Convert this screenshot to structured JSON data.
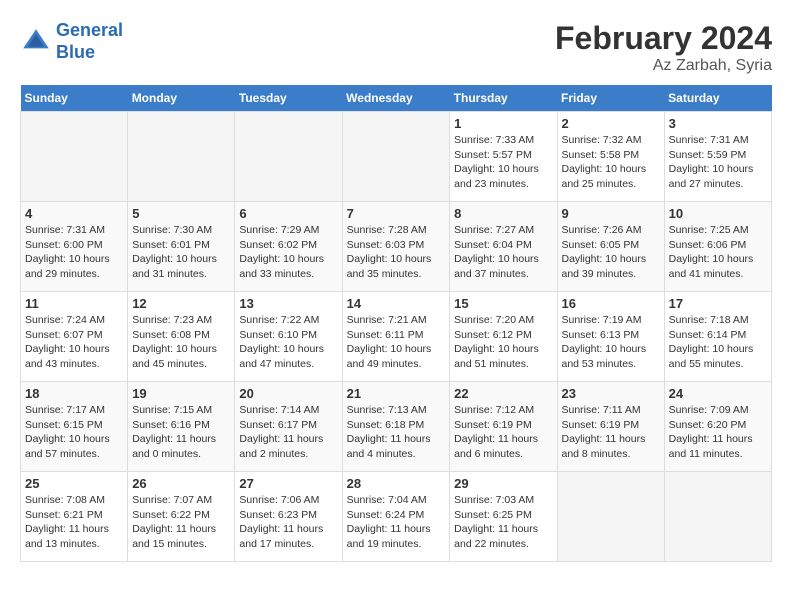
{
  "header": {
    "logo_line1": "General",
    "logo_line2": "Blue",
    "month_year": "February 2024",
    "location": "Az Zarbah, Syria"
  },
  "weekdays": [
    "Sunday",
    "Monday",
    "Tuesday",
    "Wednesday",
    "Thursday",
    "Friday",
    "Saturday"
  ],
  "weeks": [
    [
      {
        "day": "",
        "info": ""
      },
      {
        "day": "",
        "info": ""
      },
      {
        "day": "",
        "info": ""
      },
      {
        "day": "",
        "info": ""
      },
      {
        "day": "1",
        "info": "Sunrise: 7:33 AM\nSunset: 5:57 PM\nDaylight: 10 hours\nand 23 minutes."
      },
      {
        "day": "2",
        "info": "Sunrise: 7:32 AM\nSunset: 5:58 PM\nDaylight: 10 hours\nand 25 minutes."
      },
      {
        "day": "3",
        "info": "Sunrise: 7:31 AM\nSunset: 5:59 PM\nDaylight: 10 hours\nand 27 minutes."
      }
    ],
    [
      {
        "day": "4",
        "info": "Sunrise: 7:31 AM\nSunset: 6:00 PM\nDaylight: 10 hours\nand 29 minutes."
      },
      {
        "day": "5",
        "info": "Sunrise: 7:30 AM\nSunset: 6:01 PM\nDaylight: 10 hours\nand 31 minutes."
      },
      {
        "day": "6",
        "info": "Sunrise: 7:29 AM\nSunset: 6:02 PM\nDaylight: 10 hours\nand 33 minutes."
      },
      {
        "day": "7",
        "info": "Sunrise: 7:28 AM\nSunset: 6:03 PM\nDaylight: 10 hours\nand 35 minutes."
      },
      {
        "day": "8",
        "info": "Sunrise: 7:27 AM\nSunset: 6:04 PM\nDaylight: 10 hours\nand 37 minutes."
      },
      {
        "day": "9",
        "info": "Sunrise: 7:26 AM\nSunset: 6:05 PM\nDaylight: 10 hours\nand 39 minutes."
      },
      {
        "day": "10",
        "info": "Sunrise: 7:25 AM\nSunset: 6:06 PM\nDaylight: 10 hours\nand 41 minutes."
      }
    ],
    [
      {
        "day": "11",
        "info": "Sunrise: 7:24 AM\nSunset: 6:07 PM\nDaylight: 10 hours\nand 43 minutes."
      },
      {
        "day": "12",
        "info": "Sunrise: 7:23 AM\nSunset: 6:08 PM\nDaylight: 10 hours\nand 45 minutes."
      },
      {
        "day": "13",
        "info": "Sunrise: 7:22 AM\nSunset: 6:10 PM\nDaylight: 10 hours\nand 47 minutes."
      },
      {
        "day": "14",
        "info": "Sunrise: 7:21 AM\nSunset: 6:11 PM\nDaylight: 10 hours\nand 49 minutes."
      },
      {
        "day": "15",
        "info": "Sunrise: 7:20 AM\nSunset: 6:12 PM\nDaylight: 10 hours\nand 51 minutes."
      },
      {
        "day": "16",
        "info": "Sunrise: 7:19 AM\nSunset: 6:13 PM\nDaylight: 10 hours\nand 53 minutes."
      },
      {
        "day": "17",
        "info": "Sunrise: 7:18 AM\nSunset: 6:14 PM\nDaylight: 10 hours\nand 55 minutes."
      }
    ],
    [
      {
        "day": "18",
        "info": "Sunrise: 7:17 AM\nSunset: 6:15 PM\nDaylight: 10 hours\nand 57 minutes."
      },
      {
        "day": "19",
        "info": "Sunrise: 7:15 AM\nSunset: 6:16 PM\nDaylight: 11 hours\nand 0 minutes."
      },
      {
        "day": "20",
        "info": "Sunrise: 7:14 AM\nSunset: 6:17 PM\nDaylight: 11 hours\nand 2 minutes."
      },
      {
        "day": "21",
        "info": "Sunrise: 7:13 AM\nSunset: 6:18 PM\nDaylight: 11 hours\nand 4 minutes."
      },
      {
        "day": "22",
        "info": "Sunrise: 7:12 AM\nSunset: 6:19 PM\nDaylight: 11 hours\nand 6 minutes."
      },
      {
        "day": "23",
        "info": "Sunrise: 7:11 AM\nSunset: 6:19 PM\nDaylight: 11 hours\nand 8 minutes."
      },
      {
        "day": "24",
        "info": "Sunrise: 7:09 AM\nSunset: 6:20 PM\nDaylight: 11 hours\nand 11 minutes."
      }
    ],
    [
      {
        "day": "25",
        "info": "Sunrise: 7:08 AM\nSunset: 6:21 PM\nDaylight: 11 hours\nand 13 minutes."
      },
      {
        "day": "26",
        "info": "Sunrise: 7:07 AM\nSunset: 6:22 PM\nDaylight: 11 hours\nand 15 minutes."
      },
      {
        "day": "27",
        "info": "Sunrise: 7:06 AM\nSunset: 6:23 PM\nDaylight: 11 hours\nand 17 minutes."
      },
      {
        "day": "28",
        "info": "Sunrise: 7:04 AM\nSunset: 6:24 PM\nDaylight: 11 hours\nand 19 minutes."
      },
      {
        "day": "29",
        "info": "Sunrise: 7:03 AM\nSunset: 6:25 PM\nDaylight: 11 hours\nand 22 minutes."
      },
      {
        "day": "",
        "info": ""
      },
      {
        "day": "",
        "info": ""
      }
    ]
  ]
}
